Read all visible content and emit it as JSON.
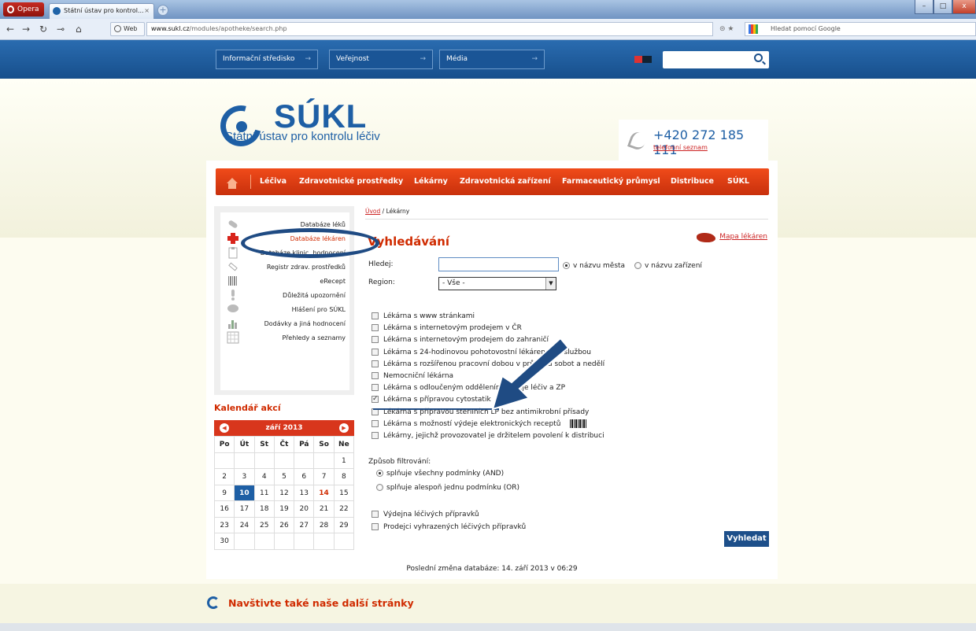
{
  "browser": {
    "opera_label": "Opera",
    "tab_title": "Státní ústav pro kontrol...",
    "tab_close": "×",
    "new_tab": "+",
    "web_badge": "Web",
    "url_host": "www.sukl.cz",
    "url_path": "/modules/apotheke/search.php",
    "search_placeholder": "Hledat pomocí Google",
    "win_min": "–",
    "win_max": "□",
    "win_close": "x"
  },
  "topnav": {
    "items": [
      "Informační středisko",
      "Veřejnost",
      "Média"
    ],
    "arrow": "→"
  },
  "header": {
    "logo": "SÚKL",
    "subtitle": "Státní ústav pro kontrolu léčiv",
    "phone": "+420 272 185 111",
    "phone_link": "telefonní seznam"
  },
  "mainmenu": {
    "items": [
      "Léčiva",
      "Zdravotnické prostředky",
      "Lékárny",
      "Zdravotnická zařízení",
      "Farmaceutický průmysl",
      "Distribuce",
      "SÚKL"
    ]
  },
  "sidebar": {
    "items": [
      {
        "label": "Databáze léků",
        "icon": "pill-icon"
      },
      {
        "label": "Databáze lékáren",
        "icon": "red-cross-icon"
      },
      {
        "label": "Databáze klinic. hodnocení",
        "icon": "clipboard-icon"
      },
      {
        "label": "Registr zdrav. prostředků",
        "icon": "syringe-icon"
      },
      {
        "label": "eRecept",
        "icon": "barcode-icon"
      },
      {
        "label": "Důležitá upozornění",
        "icon": "exclamation-icon"
      },
      {
        "label": "Hlášení pro SÚKL",
        "icon": "speech-bubble-icon"
      },
      {
        "label": "Dodávky a jiná hodnocení",
        "icon": "bar-chart-icon"
      },
      {
        "label": "Přehledy a seznamy",
        "icon": "grid-icon"
      }
    ]
  },
  "calendar": {
    "title": "Kalendář akcí",
    "month": "září 2013",
    "days_of_week": [
      "Po",
      "Út",
      "St",
      "Čt",
      "Pá",
      "So",
      "Ne"
    ],
    "weeks": [
      [
        "",
        "",
        "",
        "",
        "",
        "",
        "1"
      ],
      [
        "2",
        "3",
        "4",
        "5",
        "6",
        "7",
        "8"
      ],
      [
        "9",
        "10",
        "11",
        "12",
        "13",
        "14",
        "15"
      ],
      [
        "16",
        "17",
        "18",
        "19",
        "20",
        "21",
        "22"
      ],
      [
        "23",
        "24",
        "25",
        "26",
        "27",
        "28",
        "29"
      ],
      [
        "30",
        "",
        "",
        "",
        "",
        "",
        ""
      ]
    ],
    "today": "10",
    "highlight": "14"
  },
  "content": {
    "breadcrumb_home": "Úvod",
    "breadcrumb_sep": " / ",
    "breadcrumb_current": "Lékárny",
    "heading": "Vyhledávání",
    "map_link": "Mapa lékáren",
    "search_label": "Hledej:",
    "search_value": "",
    "radio_city": "v názvu města",
    "radio_facility": "v názvu zařízení",
    "region_label": "Region:",
    "region_value": "- Vše -",
    "checkboxes": [
      {
        "label": "Lékárna s www stránkami",
        "checked": false
      },
      {
        "label": "Lékárna s internetovým prodejem v ČR",
        "checked": false
      },
      {
        "label": "Lékárna s internetovým prodejem do zahraničí",
        "checked": false
      },
      {
        "label": "Lékárna s 24-hodinovou pohotovostní lékárenskou službou",
        "checked": false
      },
      {
        "label": "Lékárna s rozšířenou pracovní dobou v průběhu sobot a nedělí",
        "checked": false
      },
      {
        "label": "Nemocniční lékárna",
        "checked": false
      },
      {
        "label": "Lékárna s odloučeným oddělením výdeje léčiv a ZP",
        "checked": false
      },
      {
        "label": "Lékárna s přípravou cytostatik",
        "checked": true
      },
      {
        "label": "Lékárna s přípravou sterilních LP bez antimikrobní přísady",
        "checked": false
      },
      {
        "label": "Lékárna s možností výdeje elektronických receptů",
        "checked": false
      },
      {
        "label": "Lékárny, jejichž provozovatel je držitelem povolení k distribuci",
        "checked": false
      }
    ],
    "filter_label": "Způsob filtrování:",
    "filter_and": "splňuje všechny podmínky (AND)",
    "filter_or": "splňuje alespoň jednu podmínku (OR)",
    "extra_checkboxes": [
      {
        "label": "Výdejna léčivých přípravků",
        "checked": false
      },
      {
        "label": "Prodejci vyhrazených léčivých přípravků",
        "checked": false
      }
    ],
    "submit": "Vyhledat",
    "last_change": "Poslední změna databáze: 14. září 2013 v 06:29"
  },
  "footer": {
    "text": "Navštivte také naše další stránky"
  },
  "colors": {
    "brand_blue": "#1e5fa5",
    "brand_red": "#d02b00",
    "annotation_blue": "#1f4b83"
  }
}
